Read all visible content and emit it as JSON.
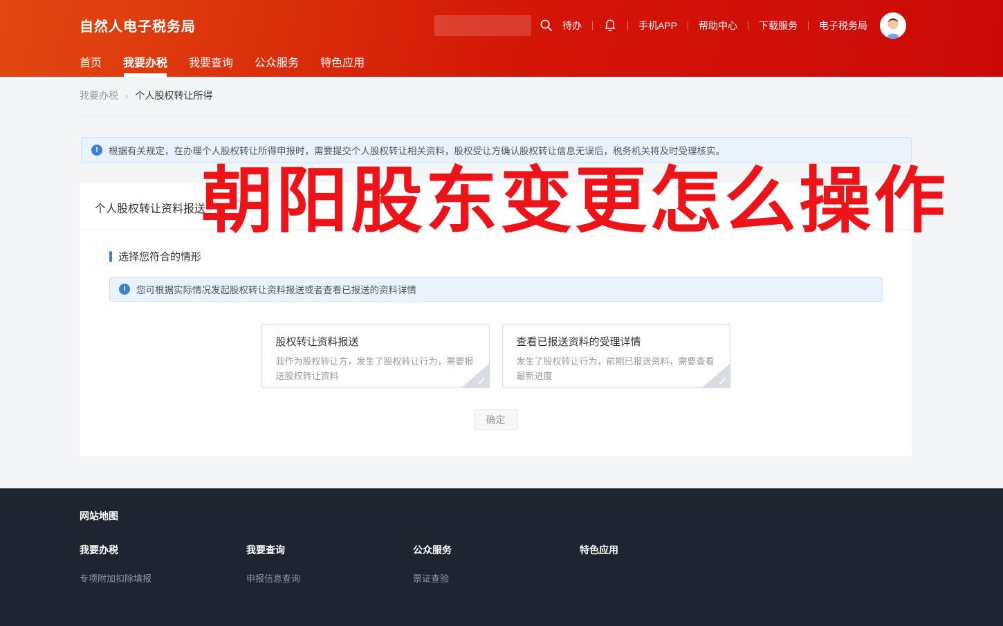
{
  "header": {
    "logo": "自然人电子税务局",
    "search": {
      "value": "",
      "placeholder": ""
    },
    "quick_links": {
      "todo": "待办",
      "mobile_app": "手机APP",
      "help_center": "帮助中心",
      "download": "下载服务",
      "etax": "电子税务局"
    },
    "nav": [
      {
        "label": "首页"
      },
      {
        "label": "我要办税"
      },
      {
        "label": "我要查询"
      },
      {
        "label": "公众服务"
      },
      {
        "label": "特色应用"
      }
    ]
  },
  "breadcrumb": {
    "parent": "我要办税",
    "separator": "›",
    "current": "个人股权转让所得"
  },
  "alert": {
    "icon": "!",
    "text": "根据有关规定，在办理个人股权转让所得申报时，需要提交个人股权转让相关资料，股权受让方确认股权转让信息无误后，税务机关将及时受理核实。"
  },
  "panel": {
    "title": "个人股权转让资料报送",
    "section_title": "选择您符合的情形",
    "hint_icon": "!",
    "hint": "您可根据实际情况发起股权转让资料报送或者查看已报送的资料详情",
    "options": [
      {
        "title": "股权转让资料报送",
        "desc": "我作为股权转让方，发生了股权转让行为，需要报送股权转让资料",
        "check": "✓"
      },
      {
        "title": "查看已报送资料的受理详情",
        "desc": "发生了股权转让行为，前期已报送资料，需要查看最新进度",
        "check": "✓"
      }
    ],
    "confirm_label": "确定"
  },
  "watermark": "朝阳股东变更怎么操作",
  "footer": {
    "sitemap_title": "网站地图",
    "columns": [
      {
        "title": "我要办税",
        "items": [
          "专项附加扣除填报"
        ]
      },
      {
        "title": "我要查询",
        "items": [
          "申报信息查询"
        ]
      },
      {
        "title": "公众服务",
        "items": [
          "票证查验"
        ]
      },
      {
        "title": "特色应用",
        "items": []
      }
    ]
  },
  "colors": {
    "header_gradient_left": "#e24a10",
    "header_gradient_right": "#cb0a08",
    "alert_bg": "#eaf3fd",
    "alert_border": "#cbdff6",
    "info_blue": "#3a80d9",
    "section_bar_blue": "#3d80da",
    "watermark_red": "#ed1419",
    "footer_bg": "#1e2531",
    "page_bg": "#f4f5f7"
  }
}
